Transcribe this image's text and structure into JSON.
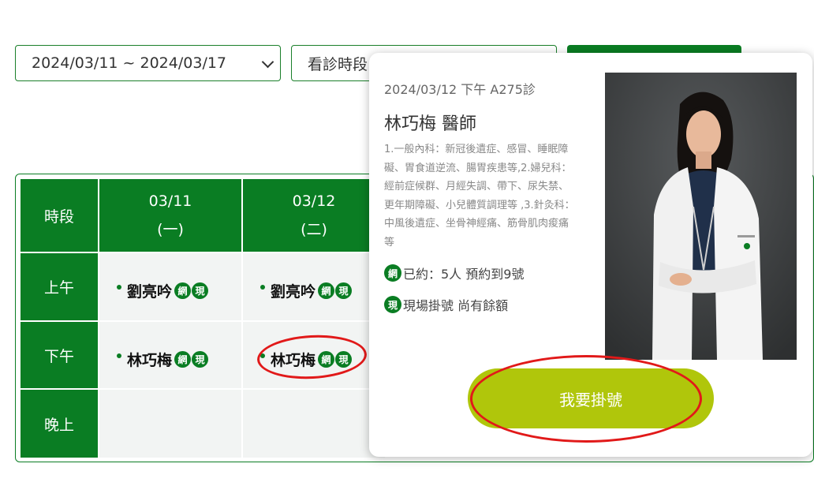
{
  "filters": {
    "date_range": "2024/03/11 ~ 2024/03/17",
    "period_select": "看診時段"
  },
  "table": {
    "corner_header": "時段",
    "dates": [
      {
        "date": "03/11",
        "weekday": "(一)"
      },
      {
        "date": "03/12",
        "weekday": "(二)"
      }
    ],
    "rows": [
      {
        "label": "上午",
        "doctors": [
          "劉亮吟",
          "劉亮吟"
        ]
      },
      {
        "label": "下午",
        "doctors": [
          "林巧梅",
          "林巧梅"
        ]
      },
      {
        "label": "晚上",
        "doctors": []
      }
    ],
    "badge_net": "網",
    "badge_onsite": "現"
  },
  "popup": {
    "slot": "2024/03/12 下午 A275診",
    "doctor_title": "林巧梅 醫師",
    "specialty": "1.一般內科：新冠後遺症、感冒、睡眠障礙、胃食道逆流、腸胃疾患等,2.婦兒科：經前症候群、月經失調、帶下、尿失禁、更年期障礙、小兒體質調理等 ,3.針灸科：中風後遺症、坐骨神經痛、筋骨肌肉痠痛等",
    "net_badge": "網",
    "net_status": "已約：5人 預約到9號",
    "onsite_badge": "現",
    "onsite_status": "現場掛號 尚有餘額",
    "register_button": "我要掛號"
  },
  "colors": {
    "primary_green": "#0a7d23",
    "register_button": "#b0c60b",
    "annotation_red": "#e11919"
  }
}
